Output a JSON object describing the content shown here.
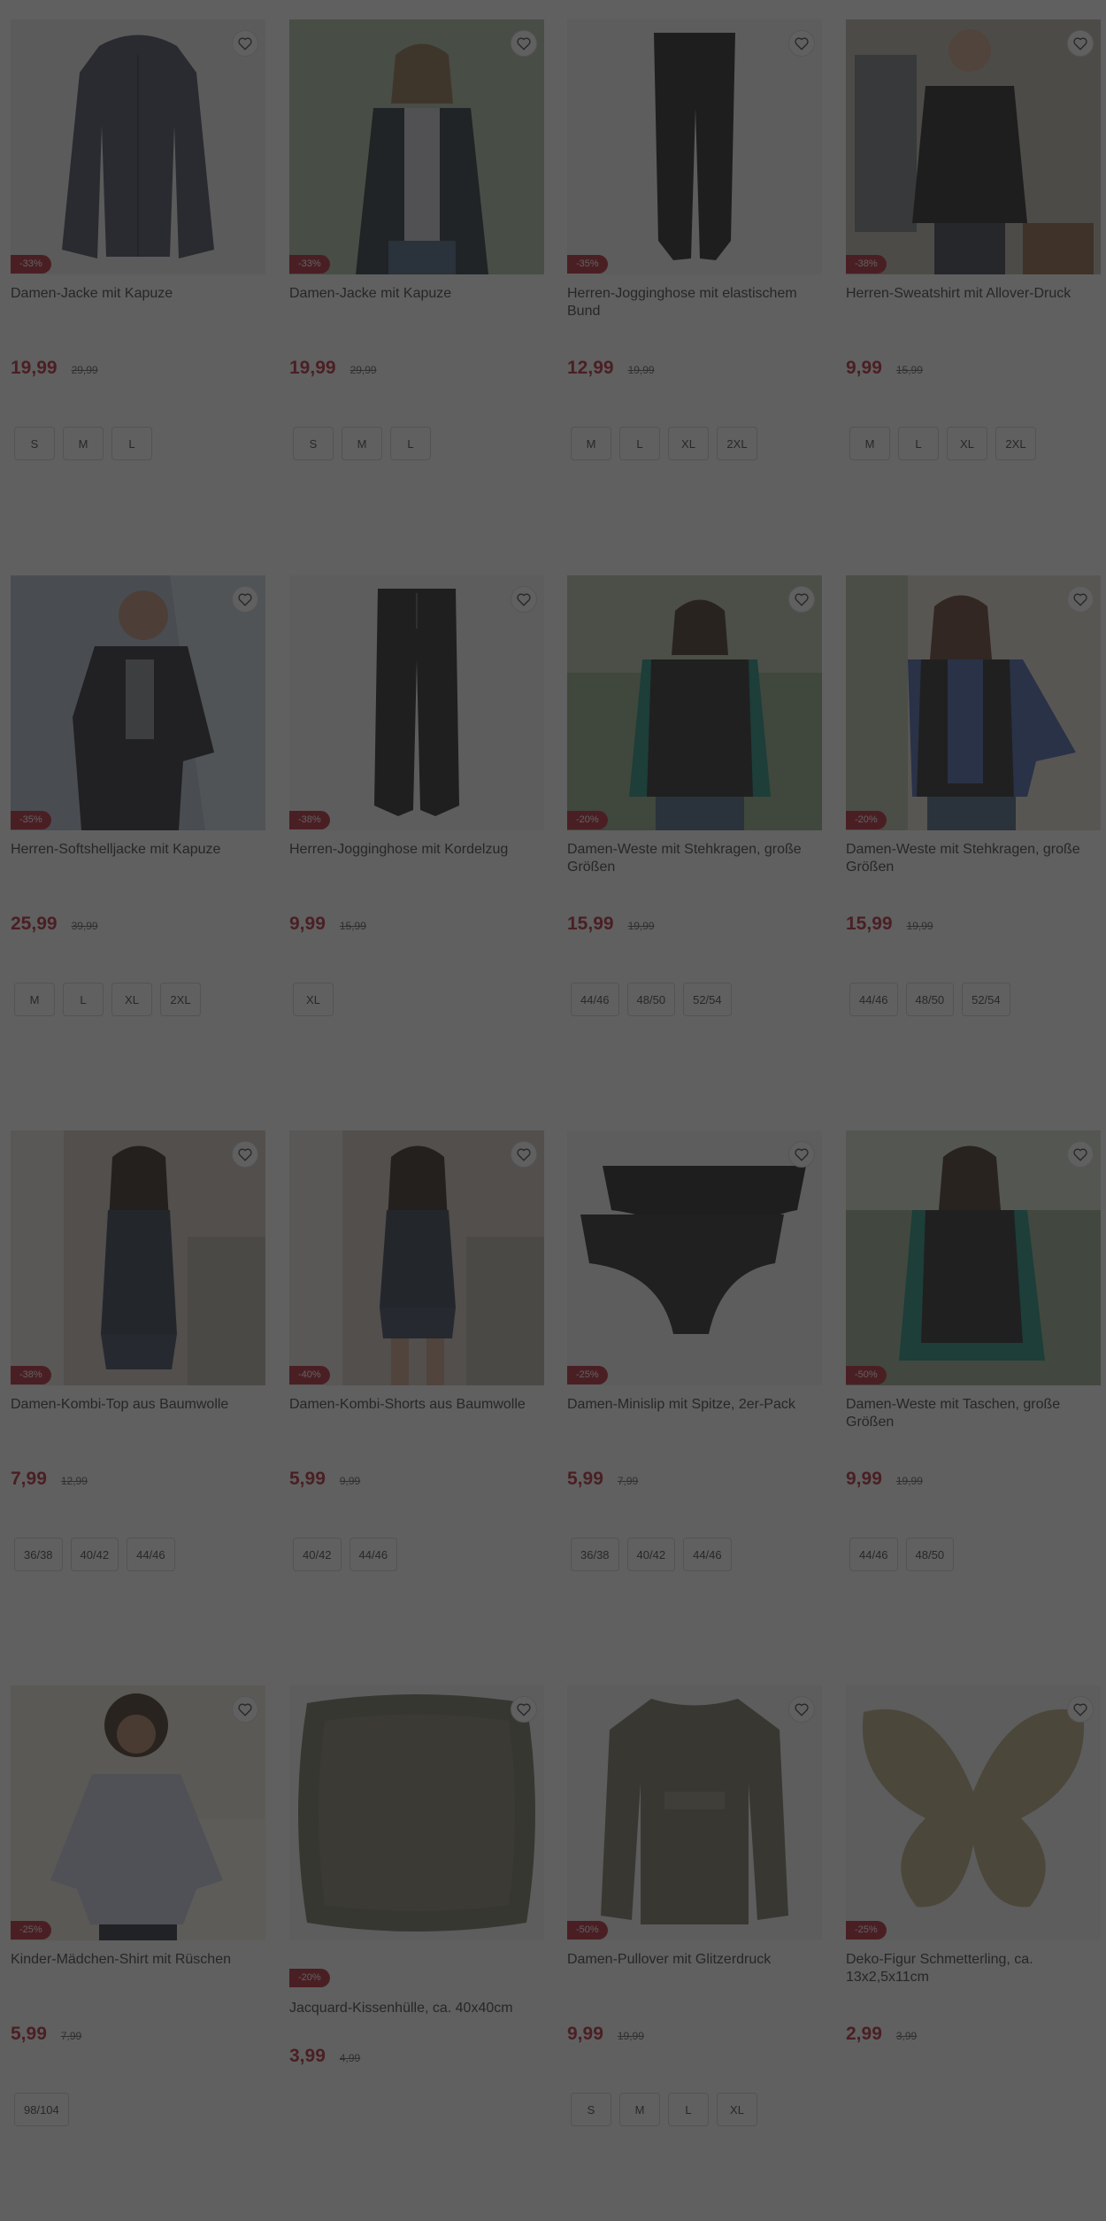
{
  "colors": {
    "accent": "#b0182a",
    "overlay": "rgba(35,35,35,0.72)"
  },
  "products": [
    {
      "id": "p1",
      "title": "Damen-Jacke mit Kapuze",
      "price": "19,99",
      "old_price": "29,99",
      "badge": "-33%",
      "sizes": [
        "S",
        "M",
        "L"
      ],
      "image_icon": "jacket-image"
    },
    {
      "id": "p2",
      "title": "Damen-Jacke mit Kapuze",
      "price": "19,99",
      "old_price": "29,99",
      "badge": "-33%",
      "sizes": [
        "S",
        "M",
        "L"
      ],
      "image_icon": "woman-jacket-image"
    },
    {
      "id": "p3",
      "title": "Herren-Jogginghose mit elastischem Bund",
      "price": "12,99",
      "old_price": "19,99",
      "badge": "-35%",
      "sizes": [
        "M",
        "L",
        "XL",
        "2XL"
      ],
      "image_icon": "pants-image"
    },
    {
      "id": "p4",
      "title": "Herren-Sweatshirt mit Allover-Druck",
      "price": "9,99",
      "old_price": "15,99",
      "badge": "-38%",
      "sizes": [
        "M",
        "L",
        "XL",
        "2XL"
      ],
      "image_icon": "man-sweatshirt-image"
    },
    {
      "id": "p5",
      "title": "Herren-Softshelljacke mit Kapuze",
      "price": "25,99",
      "old_price": "39,99",
      "badge": "-35%",
      "sizes": [
        "M",
        "L",
        "XL",
        "2XL"
      ],
      "image_icon": "man-jacket-image"
    },
    {
      "id": "p6",
      "title": "Herren-Jogginghose mit Kordelzug",
      "price": "9,99",
      "old_price": "15,99",
      "badge": "-38%",
      "sizes": [
        "XL"
      ],
      "image_icon": "pants-image"
    },
    {
      "id": "p7",
      "title": "Damen-Weste mit Stehkragen, große Größen",
      "price": "15,99",
      "old_price": "19,99",
      "badge": "-20%",
      "sizes": [
        "44/46",
        "48/50",
        "52/54"
      ],
      "image_icon": "woman-vest-image"
    },
    {
      "id": "p8",
      "title": "Damen-Weste mit Stehkragen, große Größen",
      "price": "15,99",
      "old_price": "19,99",
      "badge": "-20%",
      "sizes": [
        "44/46",
        "48/50",
        "52/54"
      ],
      "image_icon": "woman-vest-image"
    },
    {
      "id": "p9",
      "title": "Damen-Kombi-Top aus Baumwolle",
      "price": "7,99",
      "old_price": "12,99",
      "badge": "-38%",
      "sizes": [
        "36/38",
        "40/42",
        "44/46"
      ],
      "image_icon": "woman-top-image"
    },
    {
      "id": "p10",
      "title": "Damen-Kombi-Shorts aus Baumwolle",
      "price": "5,99",
      "old_price": "9,99",
      "badge": "-40%",
      "sizes": [
        "40/42",
        "44/46"
      ],
      "image_icon": "woman-shorts-image"
    },
    {
      "id": "p11",
      "title": "Damen-Minislip mit Spitze, 2er-Pack",
      "price": "5,99",
      "old_price": "7,99",
      "badge": "-25%",
      "sizes": [
        "36/38",
        "40/42",
        "44/46"
      ],
      "image_icon": "slip-image"
    },
    {
      "id": "p12",
      "title": "Damen-Weste mit Taschen, große Größen",
      "price": "9,99",
      "old_price": "19,99",
      "badge": "-50%",
      "sizes": [
        "44/46",
        "48/50"
      ],
      "image_icon": "woman-vest-image"
    },
    {
      "id": "p13",
      "title": "Kinder-Mädchen-Shirt mit Rüschen",
      "price": "5,99",
      "old_price": "7,99",
      "badge": "-25%",
      "sizes": [
        "98/104"
      ],
      "image_icon": "girl-shirt-image"
    },
    {
      "id": "p14",
      "title": "Jacquard-Kissenhülle, ca. 40x40cm",
      "price": "3,99",
      "old_price": "4,99",
      "badge": "-20%",
      "sizes": [],
      "image_icon": "cushion-image"
    },
    {
      "id": "p15",
      "title": "Damen-Pullover mit Glitzerdruck",
      "price": "9,99",
      "old_price": "19,99",
      "badge": "-50%",
      "sizes": [
        "S",
        "M",
        "L",
        "XL"
      ],
      "image_icon": "sweater-image"
    },
    {
      "id": "p16",
      "title": "Deko-Figur Schmetterling, ca. 13x2,5x11cm",
      "price": "2,99",
      "old_price": "3,99",
      "badge": "-25%",
      "sizes": [],
      "image_icon": "butterfly-figure-image"
    }
  ]
}
